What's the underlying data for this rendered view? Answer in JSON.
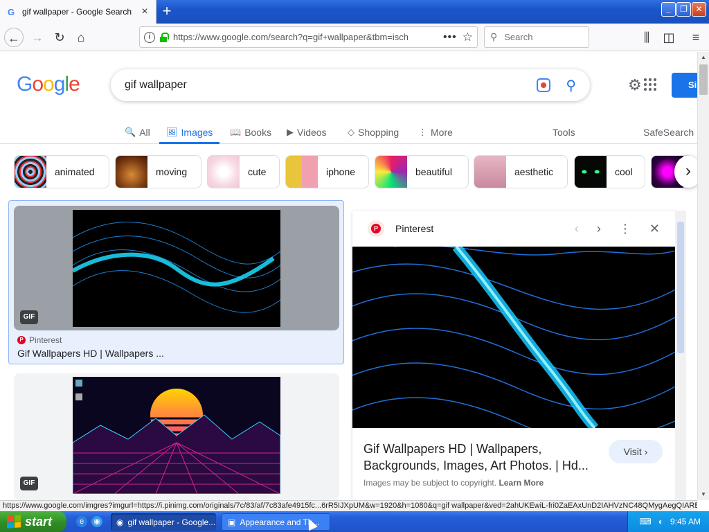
{
  "browser": {
    "tab_title": "gif wallpaper - Google Search",
    "tab_close": "×",
    "new_tab": "+",
    "url": "https://www.google.com/search?q=gif+wallpaper&tbm=isch",
    "search_placeholder": "Search",
    "page_actions": "•••",
    "status_url": "https://www.google.com/imgres?imgurl=https://i.pinimg.com/originals/7c/83/af/7c83afe4915fc...6rR5IJXpUM&w=1920&h=1080&q=gif wallpaper&ved=2ahUKEwiL-fri0ZaEAxUnD2IAHVzNC48QMygAegQIARBk"
  },
  "google": {
    "logo_letters": [
      "G",
      "o",
      "o",
      "g",
      "l",
      "e"
    ],
    "logo_colors": [
      "#4285f4",
      "#ea4335",
      "#fbbc05",
      "#4285f4",
      "#34a853",
      "#ea4335"
    ],
    "query": "gif wallpaper",
    "signin_label": "Si",
    "tabs": [
      {
        "label": "All",
        "icon": "🔍"
      },
      {
        "label": "Images",
        "icon": "🖼"
      },
      {
        "label": "Books",
        "icon": "📖"
      },
      {
        "label": "Videos",
        "icon": "▶"
      },
      {
        "label": "Shopping",
        "icon": "◇"
      },
      {
        "label": "More",
        "icon": "⋮"
      }
    ],
    "tools_label": "Tools",
    "safesearch_label": "SafeSearch",
    "chips": [
      "animated",
      "moving",
      "cute",
      "iphone",
      "beautiful",
      "aesthetic",
      "cool"
    ]
  },
  "results": [
    {
      "badge": "GIF",
      "source": "Pinterest",
      "title": "Gif Wallpapers HD | Wallpapers ..."
    },
    {
      "badge": "GIF"
    }
  ],
  "preview": {
    "source": "Pinterest",
    "title": "Gif Wallpapers HD | Wallpapers, Backgrounds, Images, Art Photos. | Hd...",
    "visit_label": "Visit",
    "copyright": "Images may be subject to copyright.",
    "learn_more": "Learn More"
  },
  "taskbar": {
    "start_label": "start",
    "tasks": [
      "gif wallpaper - Google...",
      "Appearance and Th..."
    ],
    "clock": "9:45 AM"
  }
}
